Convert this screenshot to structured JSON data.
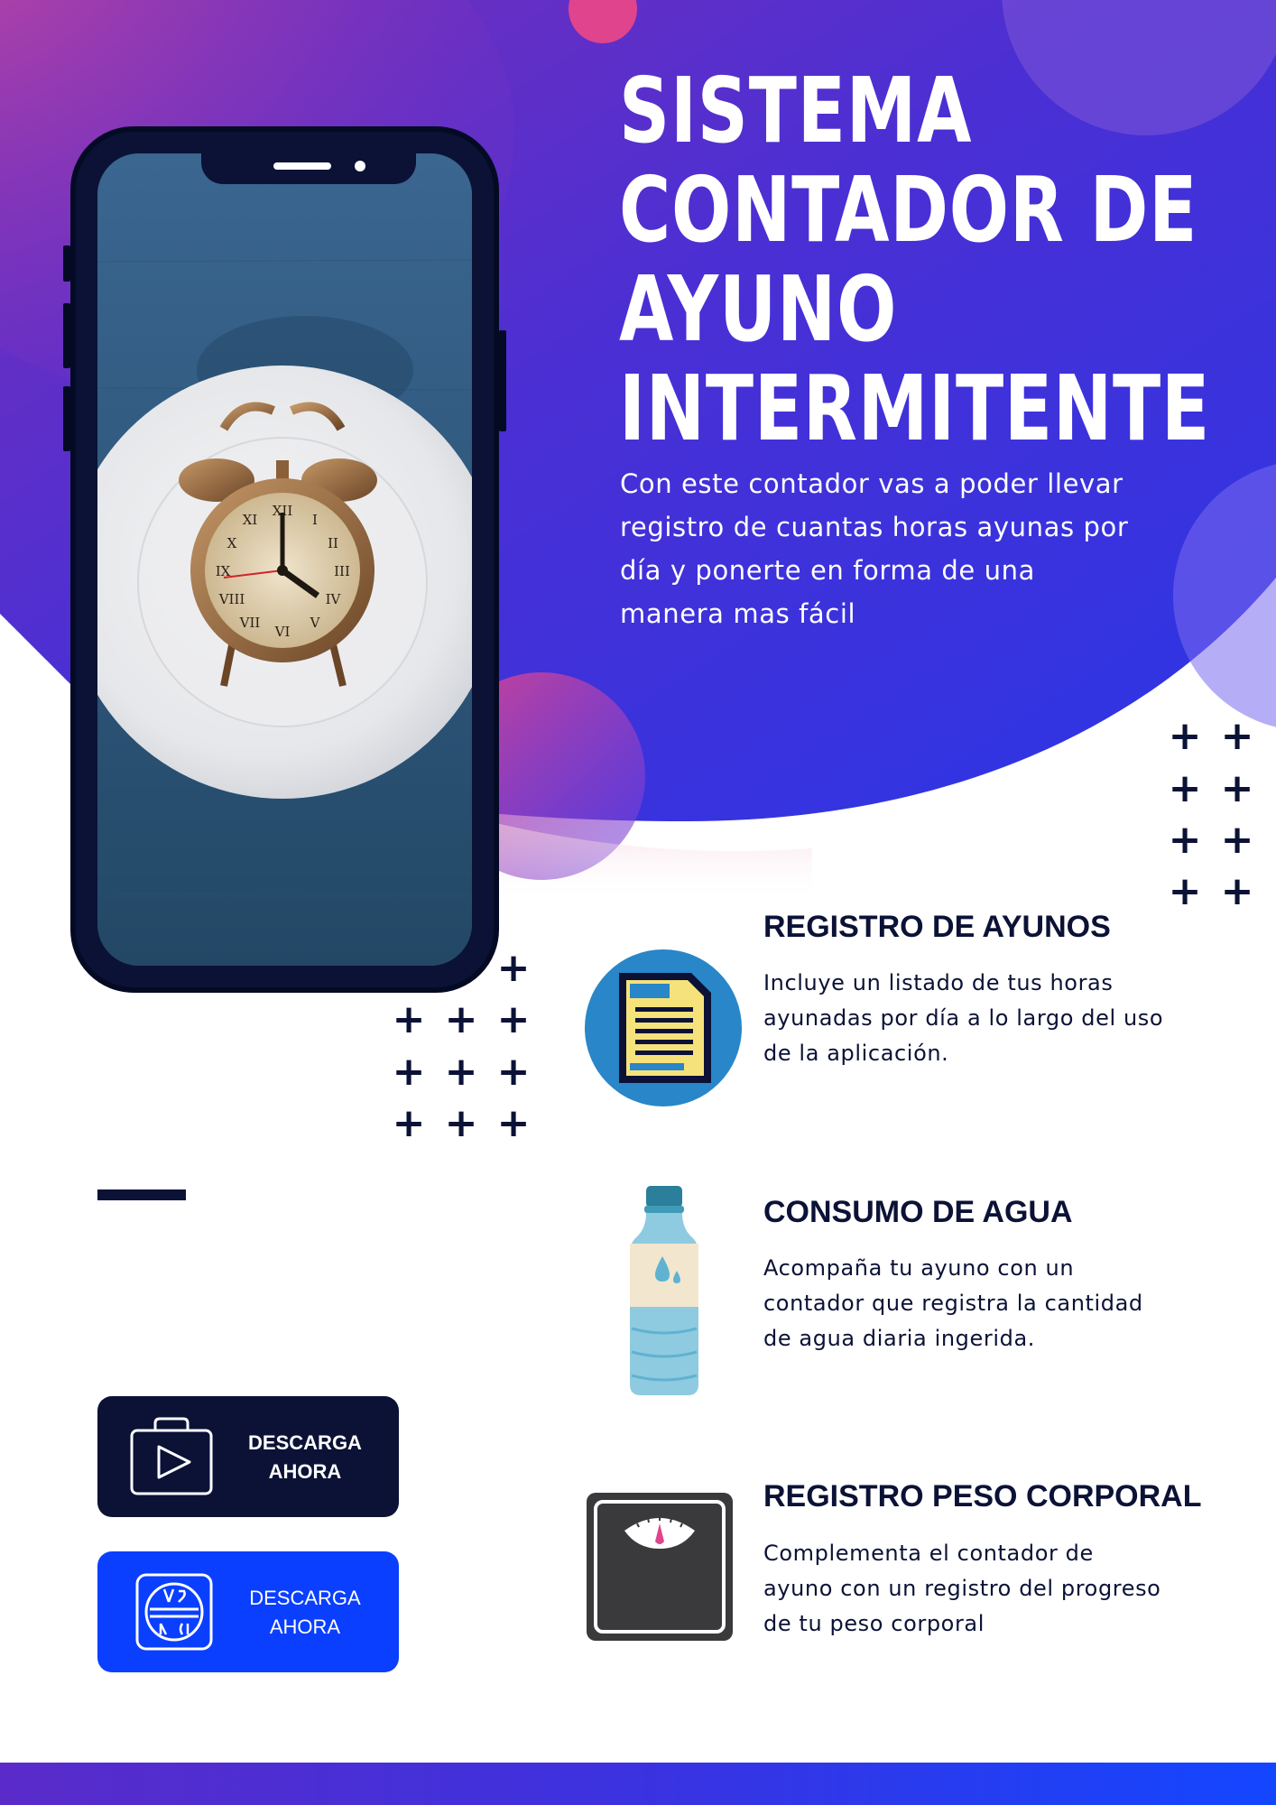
{
  "colors": {
    "navy": "#0b1236",
    "purple": "#6a2bc4",
    "blue_violet": "#3b32e0",
    "accent_blue": "#0a3fff",
    "pink": "#e04a8a"
  },
  "hero": {
    "title_lines": [
      "SISTEMA",
      "CONTADOR DE",
      "AYUNO",
      "INTERMITENTE"
    ],
    "subtitle_lines": [
      "Con este contador vas a poder llevar",
      "registro de cuantas horas ayunas por",
      "día y ponerte en forma de una",
      "manera mas fácil"
    ]
  },
  "phone": {
    "screen_image": "alarm clock on white plate over blue wooden table"
  },
  "features": [
    {
      "icon": "document-icon",
      "title": "REGISTRO DE AYUNOS",
      "lines": [
        "Incluye un listado de tus horas",
        "ayunadas por día a lo largo del uso",
        "de la aplicación."
      ]
    },
    {
      "icon": "water-bottle-icon",
      "title": "CONSUMO DE AGUA",
      "lines": [
        "Acompaña tu ayuno con un",
        "contador que registra la cantidad",
        "de agua diaria ingerida."
      ]
    },
    {
      "icon": "scale-icon",
      "title": "REGISTRO PESO CORPORAL",
      "lines": [
        "Complementa el contador de",
        "ayuno con un registro del progreso",
        "de tu peso corporal"
      ]
    }
  ],
  "buttons": [
    {
      "icon": "play-store-icon",
      "lines": [
        "DESCARGA",
        "AHORA"
      ]
    },
    {
      "icon": "app-store-icon",
      "lines": [
        "DESCARGA",
        "AHORA"
      ]
    }
  ],
  "decor": {
    "plus_symbol": "+"
  }
}
